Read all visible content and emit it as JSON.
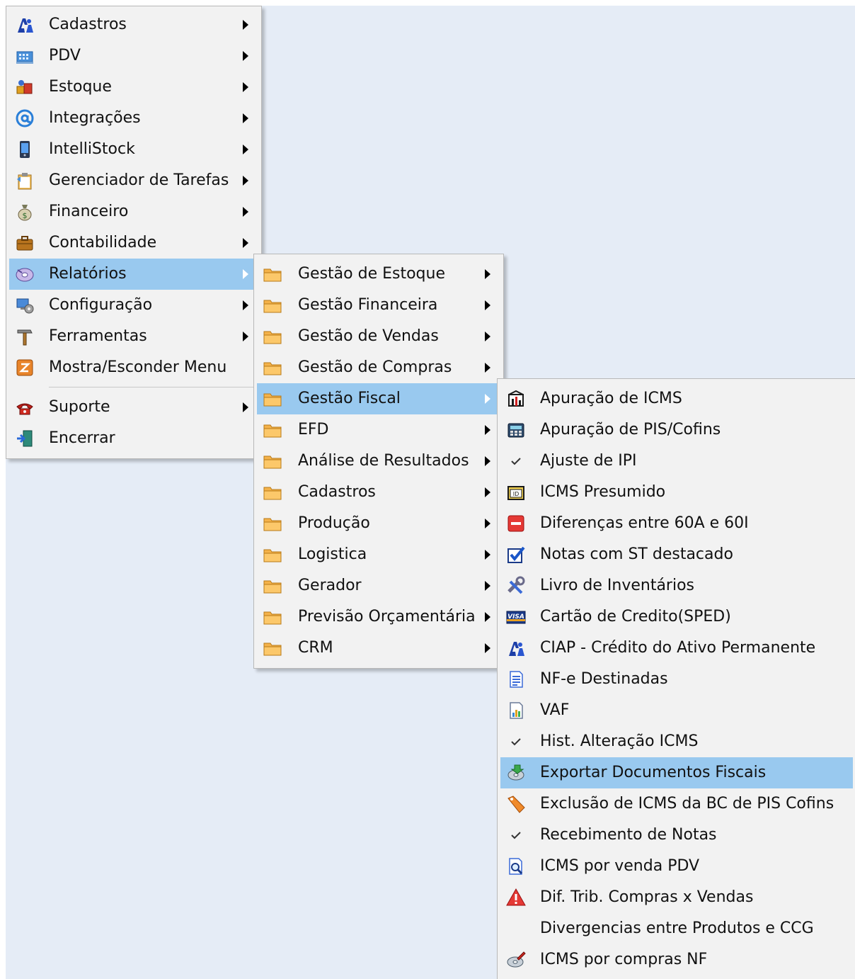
{
  "main_menu": {
    "items": [
      {
        "label": "Cadastros",
        "icon": "people-icon",
        "has_submenu": true
      },
      {
        "label": "PDV",
        "icon": "cash-register-icon",
        "has_submenu": true
      },
      {
        "label": "Estoque",
        "icon": "boxes-icon",
        "has_submenu": true
      },
      {
        "label": "Integrações",
        "icon": "at-sign-icon",
        "has_submenu": true
      },
      {
        "label": "IntelliStock",
        "icon": "mobile-device-icon",
        "has_submenu": true
      },
      {
        "label": "Gerenciador de Tarefas",
        "icon": "clipboard-icon",
        "has_submenu": true
      },
      {
        "label": "Financeiro",
        "icon": "money-bag-icon",
        "has_submenu": true
      },
      {
        "label": "Contabilidade",
        "icon": "briefcase-icon",
        "has_submenu": true
      },
      {
        "label": "Relatórios",
        "icon": "report-disk-icon",
        "has_submenu": true,
        "active": true
      },
      {
        "label": "Configuração",
        "icon": "settings-computer-icon",
        "has_submenu": true
      },
      {
        "label": "Ferramentas",
        "icon": "hammer-icon",
        "has_submenu": true
      },
      {
        "label": "Mostra/Esconder Menu",
        "icon": "toggle-menu-icon",
        "has_submenu": false
      },
      {
        "label": "Suporte",
        "icon": "telephone-icon",
        "has_submenu": true
      },
      {
        "label": "Encerrar",
        "icon": "exit-door-icon",
        "has_submenu": false
      }
    ]
  },
  "relatorios_menu": {
    "items": [
      {
        "label": "Gestão de Estoque",
        "icon": "folder-icon"
      },
      {
        "label": "Gestão Financeira",
        "icon": "folder-icon"
      },
      {
        "label": "Gestão de Vendas",
        "icon": "folder-icon"
      },
      {
        "label": "Gestão de Compras",
        "icon": "folder-icon"
      },
      {
        "label": "Gestão Fiscal",
        "icon": "folder-icon",
        "active": true
      },
      {
        "label": "EFD",
        "icon": "folder-icon"
      },
      {
        "label": "Análise de Resultados",
        "icon": "folder-icon"
      },
      {
        "label": "Cadastros",
        "icon": "folder-icon"
      },
      {
        "label": "Produção",
        "icon": "folder-icon"
      },
      {
        "label": "Logistica",
        "icon": "folder-icon"
      },
      {
        "label": "Gerador",
        "icon": "folder-icon"
      },
      {
        "label": "Previsão Orçamentária",
        "icon": "folder-icon"
      },
      {
        "label": "CRM",
        "icon": "folder-icon"
      }
    ]
  },
  "gestao_fiscal_menu": {
    "items": [
      {
        "label": "Apuração de ICMS",
        "icon": "building-chart-icon"
      },
      {
        "label": "Apuração de PIS/Cofins",
        "icon": "calculator-icon"
      },
      {
        "label": "Ajuste de IPI",
        "icon": "checkmark-icon"
      },
      {
        "label": "ICMS Presumido",
        "icon": "id-card-icon"
      },
      {
        "label": "Diferenças entre 60A e 60I",
        "icon": "red-minus-icon"
      },
      {
        "label": "Notas com ST destacado",
        "icon": "checkbox-icon"
      },
      {
        "label": "Livro de Inventários",
        "icon": "tools-icon"
      },
      {
        "label": "Cartão de Credito(SPED)",
        "icon": "visa-card-icon"
      },
      {
        "label": "CIAP - Crédito do Ativo Permanente",
        "icon": "people-icon"
      },
      {
        "label": "NF-e Destinadas",
        "icon": "document-lines-icon"
      },
      {
        "label": "VAF",
        "icon": "document-chart-icon"
      },
      {
        "label": "Hist. Alteração ICMS",
        "icon": "checkmark-icon"
      },
      {
        "label": "Exportar Documentos Fiscais",
        "icon": "export-disk-icon",
        "active": true
      },
      {
        "label": "Exclusão de ICMS da BC de PIS Cofins",
        "icon": "tag-pen-icon"
      },
      {
        "label": "Recebimento de Notas",
        "icon": "checkmark-icon"
      },
      {
        "label": "ICMS por venda PDV",
        "icon": "document-search-icon"
      },
      {
        "label": "Dif. Trib. Compras x Vendas",
        "icon": "warning-icon"
      },
      {
        "label": "Divergencias entre Produtos e CCG",
        "icon": ""
      },
      {
        "label": "ICMS por compras NF",
        "icon": "disk-pen-icon"
      }
    ]
  },
  "colors": {
    "menu_background": "#f2f2f2",
    "highlight": "#99c9ef",
    "folder": "#f4b24a",
    "desktop": "#e5ecf6"
  }
}
